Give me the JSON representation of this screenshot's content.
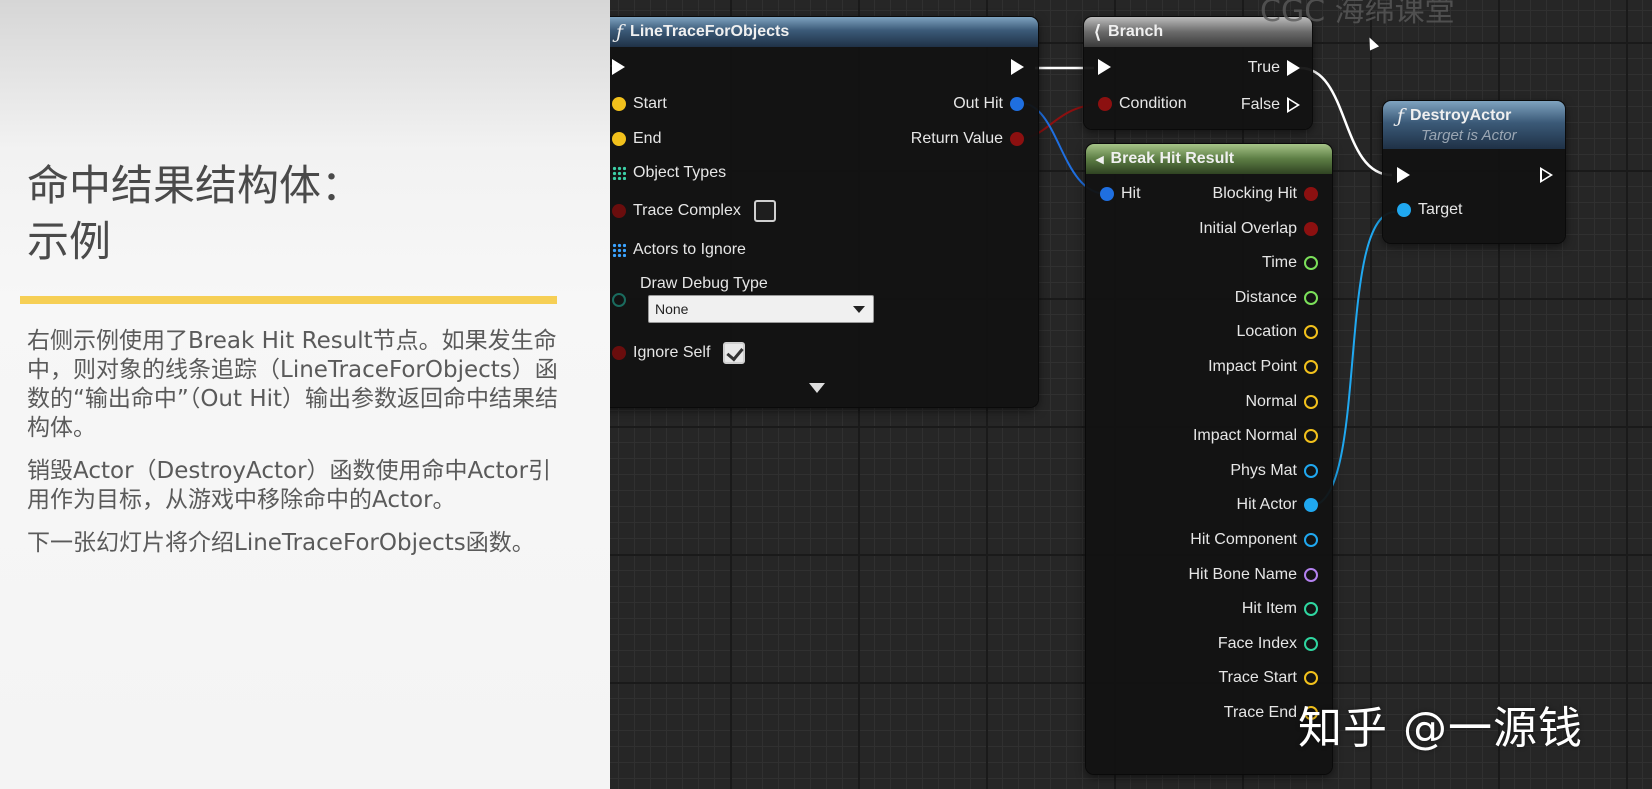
{
  "slide": {
    "title_line1": "命中结果结构体：",
    "title_line2": "示例",
    "paragraph1": "右侧示例使用了Break Hit Result节点。如果发生命中，则对象的线条追踪（LineTraceForObjects）函数的“输出命中”（Out Hit）输出参数返回命中结果结构体。",
    "paragraph2": "销毁Actor（DestroyActor）函数使用命中Actor引用作为目标，从游戏中移除命中的Actor。",
    "paragraph3": "下一张幻灯片将介绍LineTraceForObjects函数。",
    "accent_color": "#f6cf55"
  },
  "graph": {
    "line_trace": {
      "title": "LineTraceForObjects",
      "inputs": {
        "start": "Start",
        "end": "End",
        "object_types": "Object Types",
        "trace_complex": "Trace Complex",
        "actors_to_ignore": "Actors to Ignore",
        "draw_debug_type": "Draw Debug Type",
        "draw_debug_value": "None",
        "ignore_self": "Ignore Self"
      },
      "trace_complex_checked": false,
      "ignore_self_checked": true,
      "outputs": {
        "out_hit": "Out Hit",
        "return_value": "Return Value"
      }
    },
    "branch": {
      "title": "Branch",
      "condition": "Condition",
      "true_label": "True",
      "false_label": "False"
    },
    "break_hit": {
      "title": "Break Hit Result",
      "input": "Hit",
      "outputs": [
        "Blocking Hit",
        "Initial Overlap",
        "Time",
        "Distance",
        "Location",
        "Impact Point",
        "Normal",
        "Impact Normal",
        "Phys Mat",
        "Hit Actor",
        "Hit Component",
        "Hit Bone Name",
        "Hit Item",
        "Face Index",
        "Trace Start",
        "Trace End"
      ]
    },
    "destroy_actor": {
      "title": "DestroyActor",
      "subtitle": "Target is Actor",
      "target": "Target"
    }
  },
  "watermark": "知乎 @一源钱",
  "top_watermark": "CGC 海绵课堂",
  "colors": {
    "bool_pin": "#8c1010",
    "vector_pin": "#f2c11c",
    "struct_pin": "#1f6fe0",
    "object_pin": "#20a8f0",
    "float_pin": "#7be05a",
    "name_pin": "#b482f0",
    "int_pin": "#2fd6a0"
  }
}
